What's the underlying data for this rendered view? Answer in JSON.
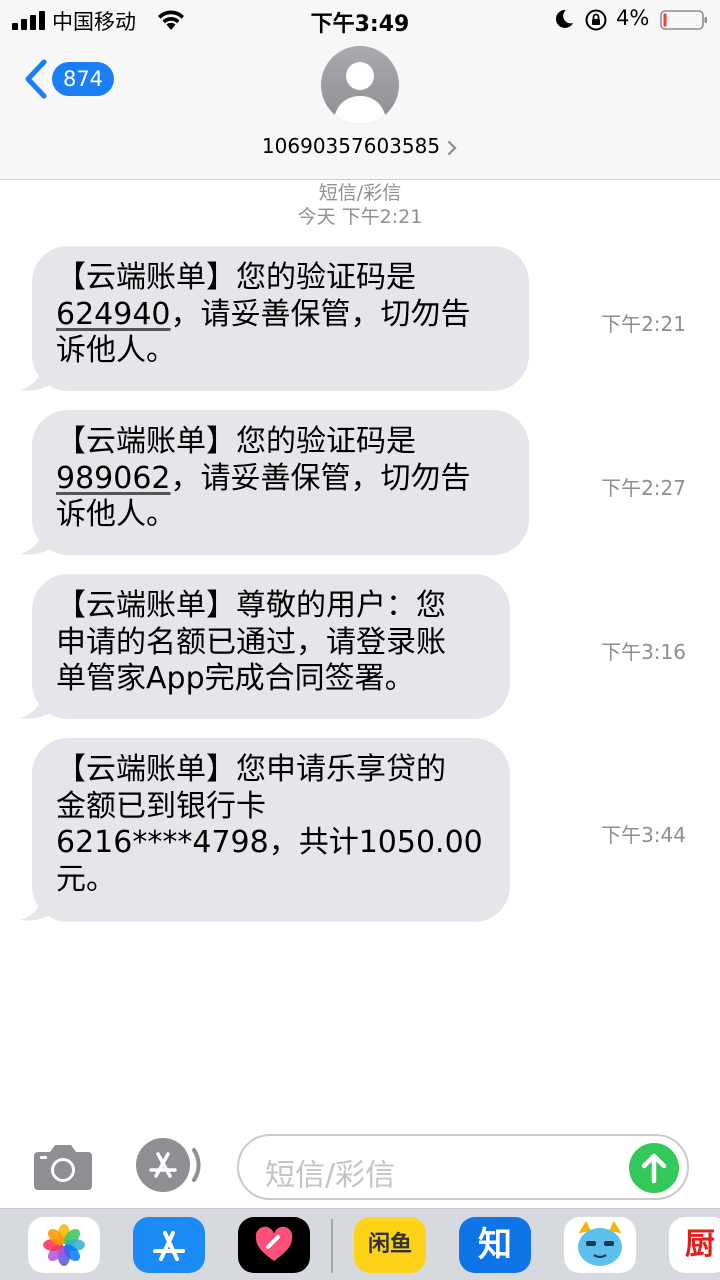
{
  "status_bar": {
    "carrier": "中国移动",
    "time": "下午3:49",
    "battery_percent": "4%"
  },
  "header": {
    "back_count": "874",
    "phone_number": "10690357603585"
  },
  "conversation": {
    "message_type": "短信/彩信",
    "date_label": "今天 下午2:21",
    "messages": [
      {
        "line1": "【云端账单】您的验证码是",
        "code": "624940",
        "line2_rest": "，请妥善保管，切勿告",
        "line3": "诉他人。",
        "time": "下午2:21"
      },
      {
        "line1": "【云端账单】您的验证码是",
        "code": "989062",
        "line2_rest": "，请妥善保管，切勿告",
        "line3": "诉他人。",
        "time": "下午2:27"
      },
      {
        "line1": "【云端账单】尊敬的用户：您",
        "line2": "申请的名额已通过，请登录账",
        "line3": "单管家App完成合同签署。",
        "time": "下午3:16"
      },
      {
        "line1": "【云端账单】您申请乐享贷的",
        "line2": "金额已到银行卡",
        "line3": "6216****4798，共计1050.00",
        "line4": "元。",
        "time": "下午3:44"
      }
    ]
  },
  "compose": {
    "placeholder": "短信/彩信"
  },
  "app_drawer": {
    "apps": [
      "photos-icon",
      "app-store-icon",
      "heart-app-icon",
      "xianyu-app-icon",
      "zhihu-app-icon",
      "cartoon-app-icon",
      "red-app-icon"
    ],
    "xianyu_label": "闲鱼",
    "zhihu_label": "知",
    "red_label": "厨"
  },
  "colors": {
    "accent": "#1a7ef5",
    "bubble": "#e5e5ea",
    "send": "#34c759",
    "meta_text": "#8e8e93"
  }
}
